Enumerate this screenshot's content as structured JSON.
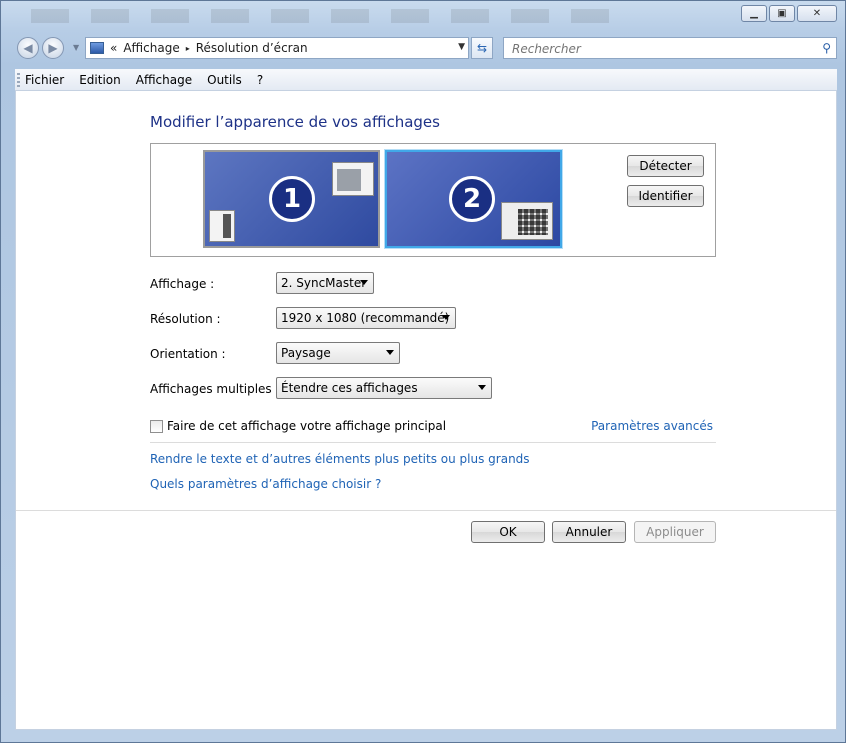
{
  "window": {
    "caption_buttons": {
      "minimize_icon": "minimize-icon",
      "maximize_icon": "maximize-icon",
      "close_icon": "close-icon"
    }
  },
  "address_bar": {
    "prefix": "«",
    "segments": [
      "Affichage",
      "Résolution d’écran"
    ],
    "separator": "▸"
  },
  "search": {
    "placeholder": "Rechercher"
  },
  "menu": {
    "items": [
      "Fichier",
      "Edition",
      "Affichage",
      "Outils",
      "?"
    ]
  },
  "main": {
    "title": "Modifier l’apparence de vos affichages",
    "monitors": [
      {
        "number": "1",
        "selected": false
      },
      {
        "number": "2",
        "selected": true
      }
    ],
    "detect_label": "Détecter",
    "identify_label": "Identifier",
    "fields": {
      "display": {
        "label": "Affichage :",
        "value": "2. SyncMaster"
      },
      "resolution": {
        "label": "Résolution :",
        "value": "1920 x 1080 (recommandé)"
      },
      "orientation": {
        "label": "Orientation :",
        "value": "Paysage"
      },
      "multiple": {
        "label": "Affichages multiples :",
        "value": "Étendre ces affichages"
      }
    },
    "primary_checkbox": {
      "label": "Faire de cet affichage votre affichage principal",
      "checked": false
    },
    "advanced_link": "Paramètres avancés",
    "links": [
      "Rendre le texte et d’autres éléments plus petits ou plus grands",
      "Quels paramètres d’affichage choisir ?"
    ],
    "buttons": {
      "ok": "OK",
      "cancel": "Annuler",
      "apply": "Appliquer"
    }
  },
  "colors": {
    "title": "#1e3287",
    "link": "#1f63b5",
    "selected_monitor_border": "#41a8e8"
  }
}
